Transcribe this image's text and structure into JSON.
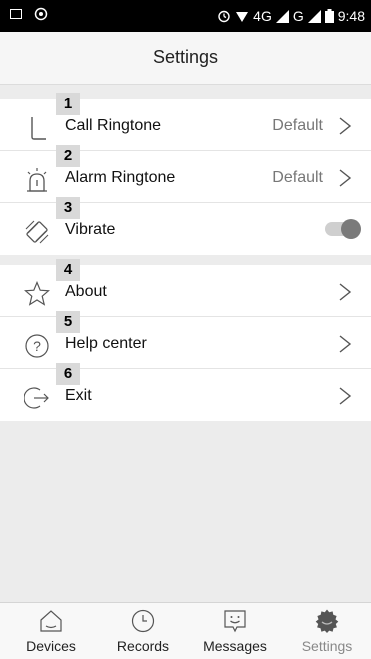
{
  "status_bar": {
    "network": "4G",
    "network2": "G",
    "time": "9:48"
  },
  "header": {
    "title": "Settings"
  },
  "section1": [
    {
      "number": "1",
      "label": "Call Ringtone",
      "value": "Default",
      "icon": "phone-ringtone-icon"
    },
    {
      "number": "2",
      "label": "Alarm Ringtone",
      "value": "Default",
      "icon": "alarm-icon"
    },
    {
      "number": "3",
      "label": "Vibrate",
      "icon": "vibrate-icon",
      "toggle_on": true
    }
  ],
  "section2": [
    {
      "number": "4",
      "label": "About",
      "icon": "star-icon"
    },
    {
      "number": "5",
      "label": "Help center",
      "icon": "question-icon"
    },
    {
      "number": "6",
      "label": "Exit",
      "icon": "exit-icon"
    }
  ],
  "tabs": [
    {
      "label": "Devices",
      "icon": "home-icon"
    },
    {
      "label": "Records",
      "icon": "clock-icon"
    },
    {
      "label": "Messages",
      "icon": "message-icon"
    },
    {
      "label": "Settings",
      "icon": "gear-icon",
      "active": true
    }
  ],
  "colors": {
    "accent_gray": "#7a7a7a",
    "badge_bg": "#d9d9d9",
    "page_bg": "#ececec"
  }
}
